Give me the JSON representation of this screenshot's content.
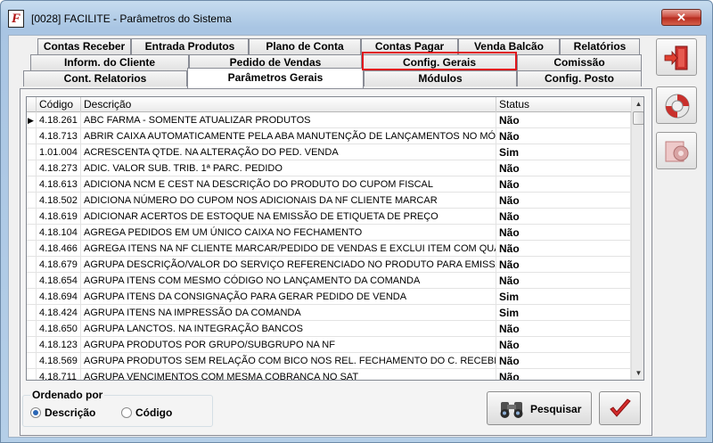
{
  "window": {
    "title": "[0028] FACILITE - Parâmetros do Sistema",
    "close_label": "✕"
  },
  "tabs": {
    "row1": [
      "Contas Receber",
      "Entrada Produtos",
      "Plano de Conta",
      "Contas Pagar",
      "Venda Balcão",
      "Relatórios"
    ],
    "row2": [
      "Inform. do Cliente",
      "Pedido de Vendas",
      "Config. Gerais",
      "Comissão"
    ],
    "row3": [
      "Cont. Relatorios",
      "Parâmetros Gerais",
      "Módulos",
      "Config. Posto"
    ],
    "active": "Parâmetros Gerais",
    "highlighted": "Config. Gerais"
  },
  "grid": {
    "columns": [
      "Código",
      "Descrição",
      "Status"
    ],
    "current_row_indicator": "▶",
    "rows": [
      [
        "4.18.261",
        "ABC FARMA - SOMENTE ATUALIZAR PRODUTOS",
        "Não"
      ],
      [
        "4.18.713",
        "ABRIR CAIXA AUTOMATICAMENTE PELA ABA MANUTENÇÃO DE LANÇAMENTOS NO MÓDULO",
        "Não"
      ],
      [
        "1.01.004",
        "ACRESCENTA QTDE. NA ALTERAÇÃO DO PED. VENDA",
        "Sim"
      ],
      [
        "4.18.273",
        "ADIC. VALOR SUB. TRIB. 1ª PARC. PEDIDO",
        "Não"
      ],
      [
        "4.18.613",
        "ADICIONA NCM E CEST NA DESCRIÇÃO DO PRODUTO DO CUPOM FISCAL",
        "Não"
      ],
      [
        "4.18.502",
        "ADICIONA NÚMERO DO CUPOM NOS ADICIONAIS DA NF CLIENTE MARCAR",
        "Não"
      ],
      [
        "4.18.619",
        "ADICIONAR ACERTOS DE ESTOQUE NA EMISSÃO DE ETIQUETA DE PREÇO",
        "Não"
      ],
      [
        "4.18.104",
        "AGREGA PEDIDOS EM UM ÚNICO CAIXA NO FECHAMENTO",
        "Não"
      ],
      [
        "4.18.466",
        "AGREGA ITENS NA NF CLIENTE MARCAR/PEDIDO DE VENDAS E EXCLUI ITEM COM QUANT",
        "Não"
      ],
      [
        "4.18.679",
        "AGRUPA DESCRIÇÃO/VALOR DO SERVIÇO REFERENCIADO NO PRODUTO PARA EMISSÃO",
        "Não"
      ],
      [
        "4.18.654",
        "AGRUPA ITENS COM MESMO CÓDIGO NO LANÇAMENTO DA COMANDA",
        "Não"
      ],
      [
        "4.18.694",
        "AGRUPA ITENS DA CONSIGNAÇÃO PARA GERAR PEDIDO DE VENDA",
        "Sim"
      ],
      [
        "4.18.424",
        "AGRUPA ITENS NA IMPRESSÃO DA COMANDA",
        "Sim"
      ],
      [
        "4.18.650",
        "AGRUPA LANCTOS. NA INTEGRAÇÃO BANCOS",
        "Não"
      ],
      [
        "4.18.123",
        "AGRUPA PRODUTOS POR GRUPO/SUBGRUPO NA NF",
        "Não"
      ],
      [
        "4.18.569",
        "AGRUPA PRODUTOS SEM RELAÇÃO COM BICO NOS REL. FECHAMENTO DO C. RECEBER",
        "Não"
      ],
      [
        "4.18.711",
        "AGRUPA VENCIMENTOS COM MESMA COBRANÇA NO SAT",
        "Não"
      ]
    ]
  },
  "order": {
    "legend": "Ordenado por",
    "option1": "Descrição",
    "option2": "Código",
    "selected": "Descrição"
  },
  "buttons": {
    "search_label": "Pesquisar"
  },
  "colors": {
    "highlight": "#e0161d",
    "accent": "#2a66b5"
  }
}
